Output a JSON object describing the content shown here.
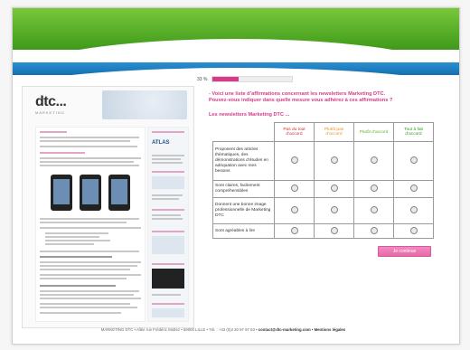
{
  "progress": {
    "percent_label": "33 %",
    "fraction": 0.33
  },
  "question": {
    "line1": "- Voici une liste d’affirmations concernant les newsletters Marketing DTC.",
    "line2": "Pouvez-vous indiquer dans quelle mesure vous adhérez à ces affirmations ?"
  },
  "subtitle": "Les newsletters Marketing DTC ...",
  "matrix": {
    "columns": [
      "Pas du tout d’accord",
      "Plutôt pas d’accord",
      "Plutôt d’accord",
      "Tout à fait d’accord"
    ],
    "rows": [
      "Proposent des articles thématiques, des démonstrations d’études en adéquation avec mes besoins",
      "Sont claires, facilement compréhensibles",
      "Donnent une bonne image professionnelle de Marketing DTC",
      "Sont agréables à lire"
    ]
  },
  "submit_label": "Je continue",
  "newsletter": {
    "logo": "dtc...",
    "logo_sub": "MARKETING",
    "brand": "ATLAS"
  },
  "footer": {
    "address": "MARKETING DTC • Allée rue Frédéric Mottez • 59000 LILLE • Tél. : +33 (0)3 20 97 97 63 • ",
    "contact": "contact@dtc-marketing.com",
    "legal": " • Mentions légales"
  },
  "colors": {
    "accent_pink": "#d63a8a",
    "green": "#4fae24",
    "blue": "#1d7fc2"
  }
}
